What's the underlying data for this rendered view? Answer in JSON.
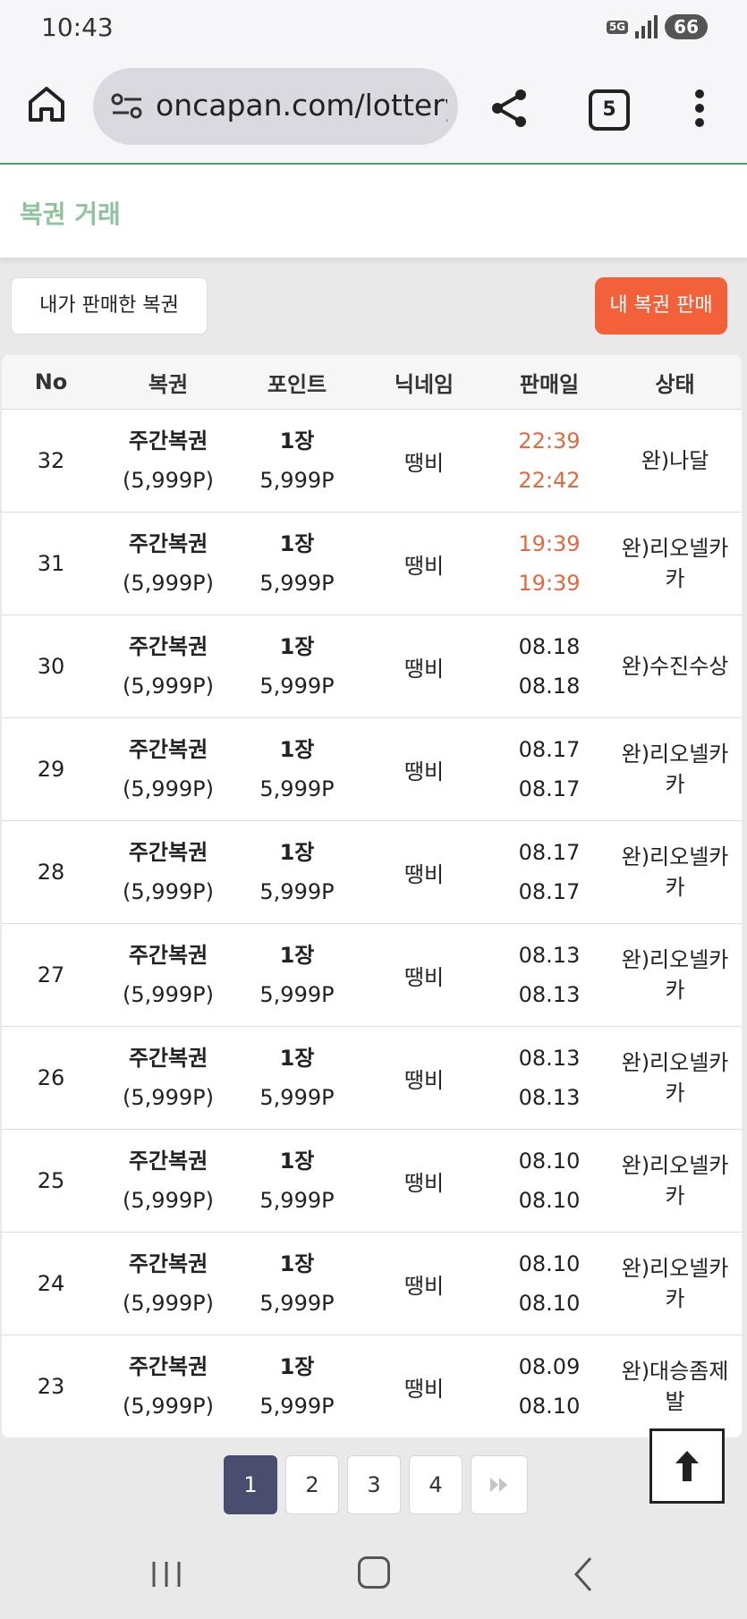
{
  "status_bar": {
    "time": "10:43",
    "network": "5G",
    "battery": "66"
  },
  "browser": {
    "url": "oncapan.com/lottery",
    "tab_count": "5"
  },
  "page": {
    "title": "복권 거래"
  },
  "actions": {
    "my_sold": "내가 판매한 복권",
    "sell_mine": "내 복권 판매"
  },
  "table": {
    "headers": {
      "no": "No",
      "lottery": "복권",
      "point": "포인트",
      "nickname": "닉네임",
      "date": "판매일",
      "status": "상태"
    },
    "rows": [
      {
        "no": "32",
        "name": "주간복권",
        "price": "(5,999P)",
        "qty": "1장",
        "points": "5,999P",
        "nickname": "땡비",
        "date1": "22:39",
        "date2": "22:42",
        "status": "완)나달"
      },
      {
        "no": "31",
        "name": "주간복권",
        "price": "(5,999P)",
        "qty": "1장",
        "points": "5,999P",
        "nickname": "땡비",
        "date1": "19:39",
        "date2": "19:39",
        "status": "완)리오넬카카"
      },
      {
        "no": "30",
        "name": "주간복권",
        "price": "(5,999P)",
        "qty": "1장",
        "points": "5,999P",
        "nickname": "땡비",
        "date1": "08.18",
        "date2": "08.18",
        "status": "완)수진수상"
      },
      {
        "no": "29",
        "name": "주간복권",
        "price": "(5,999P)",
        "qty": "1장",
        "points": "5,999P",
        "nickname": "땡비",
        "date1": "08.17",
        "date2": "08.17",
        "status": "완)리오넬카카"
      },
      {
        "no": "28",
        "name": "주간복권",
        "price": "(5,999P)",
        "qty": "1장",
        "points": "5,999P",
        "nickname": "땡비",
        "date1": "08.17",
        "date2": "08.17",
        "status": "완)리오넬카카"
      },
      {
        "no": "27",
        "name": "주간복권",
        "price": "(5,999P)",
        "qty": "1장",
        "points": "5,999P",
        "nickname": "땡비",
        "date1": "08.13",
        "date2": "08.13",
        "status": "완)리오넬카카"
      },
      {
        "no": "26",
        "name": "주간복권",
        "price": "(5,999P)",
        "qty": "1장",
        "points": "5,999P",
        "nickname": "땡비",
        "date1": "08.13",
        "date2": "08.13",
        "status": "완)리오넬카카"
      },
      {
        "no": "25",
        "name": "주간복권",
        "price": "(5,999P)",
        "qty": "1장",
        "points": "5,999P",
        "nickname": "땡비",
        "date1": "08.10",
        "date2": "08.10",
        "status": "완)리오넬카카"
      },
      {
        "no": "24",
        "name": "주간복권",
        "price": "(5,999P)",
        "qty": "1장",
        "points": "5,999P",
        "nickname": "땡비",
        "date1": "08.10",
        "date2": "08.10",
        "status": "완)리오넬카카"
      },
      {
        "no": "23",
        "name": "주간복권",
        "price": "(5,999P)",
        "qty": "1장",
        "points": "5,999P",
        "nickname": "땡비",
        "date1": "08.09",
        "date2": "08.10",
        "status": "완)대승좀제발"
      }
    ]
  },
  "pagination": {
    "pages": [
      "1",
      "2",
      "3",
      "4"
    ],
    "active": "1",
    "next_icon": "double-chevron-right-icon"
  },
  "colors": {
    "accent_green": "#8ec39e",
    "sell_orange": "#f2613a",
    "time_highlight": "#e0693f",
    "active_page": "#4a4e6e"
  }
}
